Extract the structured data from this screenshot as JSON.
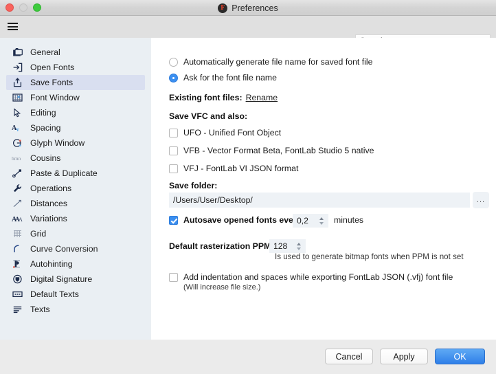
{
  "window": {
    "title": "Preferences",
    "app_logo": "fontlab-f-icon",
    "traffic_lights": [
      "close-button",
      "minimize-button",
      "maximize-button"
    ]
  },
  "toolbar": {
    "menu_icon": "hamburger-menu-icon",
    "search_placeholder": "Search",
    "search_value": ""
  },
  "sidebar": {
    "selected": "Save Fonts",
    "items": [
      {
        "label": "General",
        "icon": "folders-icon"
      },
      {
        "label": "Open Fonts",
        "icon": "arrow-into-box-icon"
      },
      {
        "label": "Save Fonts",
        "icon": "upload-box-icon"
      },
      {
        "label": "Font Window",
        "icon": "grid-table-icon"
      },
      {
        "label": "Editing",
        "icon": "cursor-arrow-icon"
      },
      {
        "label": "Spacing",
        "icon": "kerning-av-icon"
      },
      {
        "label": "Glyph Window",
        "icon": "glyph-g-icon"
      },
      {
        "label": "Cousins",
        "icon": "text-hmn-icon"
      },
      {
        "label": "Paste & Duplicate",
        "icon": "node-link-icon"
      },
      {
        "label": "Operations",
        "icon": "wrench-icon"
      },
      {
        "label": "Distances",
        "icon": "measure-line-icon"
      },
      {
        "label": "Variations",
        "icon": "variable-aaa-icon"
      },
      {
        "label": "Grid",
        "icon": "grid-icon"
      },
      {
        "label": "Curve Conversion",
        "icon": "curve-icon"
      },
      {
        "label": "Autohinting",
        "icon": "hinting-stem-icon"
      },
      {
        "label": "Digital Signature",
        "icon": "shield-check-icon"
      },
      {
        "label": "Default Texts",
        "icon": "text-box-icon"
      },
      {
        "label": "Texts",
        "icon": "text-lines-icon"
      }
    ]
  },
  "main": {
    "radio_auto_name": {
      "label": "Automatically generate file name for saved font file",
      "checked": false
    },
    "radio_ask_name": {
      "label": "Ask for the font file name",
      "checked": true
    },
    "existing_files": {
      "label": "Existing font files:",
      "link": "Rename"
    },
    "save_vfc_heading": "Save VFC and also:",
    "format_checkboxes": [
      {
        "label": "UFO - Unified Font Object",
        "checked": false
      },
      {
        "label": "VFB - Vector Format Beta, FontLab Studio 5 native",
        "checked": false
      },
      {
        "label": "VFJ - FontLab VI JSON format",
        "checked": false
      }
    ],
    "save_folder": {
      "heading": "Save folder:",
      "value": "/Users/User/Desktop/",
      "browse_label": "..."
    },
    "autosave": {
      "label": "Autosave opened fonts every",
      "checked": true,
      "value": "0,2",
      "unit": "minutes"
    },
    "rasterization": {
      "label": "Default rasterization PPM:",
      "value": "128",
      "hint": "Is used to generate bitmap fonts when PPM is not set"
    },
    "indentation": {
      "label": "Add indentation and spaces while exporting FontLab JSON (.vfj) font file",
      "sublabel": "(Will increase file size.)",
      "checked": false
    }
  },
  "footer": {
    "cancel": "Cancel",
    "apply": "Apply",
    "ok": "OK"
  },
  "colors": {
    "accent": "#3b8ff0",
    "sidebar_bg": "#eaeff3",
    "selected_bg": "#d9dff0",
    "footer_bg": "#ebebeb"
  }
}
